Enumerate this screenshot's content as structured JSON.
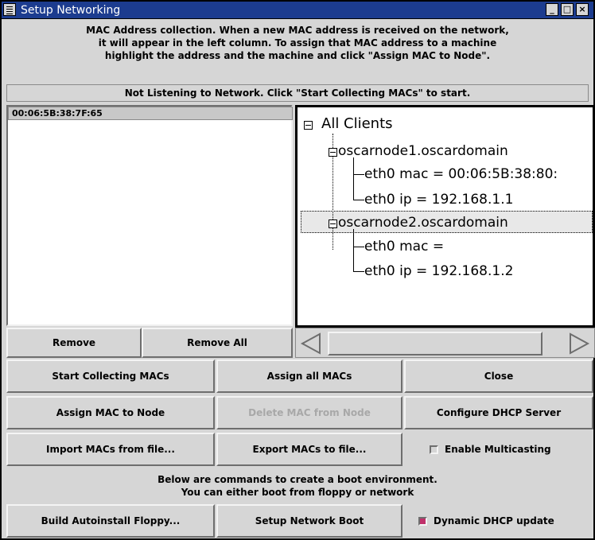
{
  "window": {
    "title": "Setup Networking"
  },
  "intro": {
    "lines": [
      "MAC Address collection.  When a new MAC address is received on the network,",
      "it will appear in the left column.  To assign that MAC address to a machine",
      "highlight the address and the machine and click \"Assign MAC to Node\"."
    ]
  },
  "status": "Not Listening to Network. Click \"Start Collecting MACs\" to start.",
  "mac_list": {
    "items": [
      "00:06:5B:38:7F:65"
    ]
  },
  "tree": {
    "root": "All Clients",
    "nodes": [
      {
        "name": "oscarnode1.oscardomain",
        "children": [
          "eth0 mac = 00:06:5B:38:80:",
          "eth0 ip = 192.168.1.1"
        ]
      },
      {
        "name": "oscarnode2.oscardomain",
        "children": [
          "eth0 mac =",
          "eth0 ip = 192.168.1.2"
        ]
      }
    ]
  },
  "list_buttons": {
    "remove": "Remove",
    "remove_all": "Remove All"
  },
  "buttons": {
    "start_collecting": "Start Collecting MACs",
    "assign_all": "Assign all MACs",
    "close": "Close",
    "assign_to_node": "Assign MAC to Node",
    "delete_from_node": "Delete MAC from Node",
    "configure_dhcp": "Configure DHCP Server",
    "import": "Import MACs from file...",
    "export": "Export MACs to file...",
    "build_floppy": "Build Autoinstall Floppy...",
    "setup_network_boot": "Setup Network Boot"
  },
  "checkboxes": {
    "multicast": {
      "label": "Enable Multicasting",
      "checked": false
    },
    "dynamic_dhcp": {
      "label": "Dynamic DHCP update",
      "checked": true
    }
  },
  "boot_note": {
    "lines": [
      "Below are commands to create a boot environment.",
      "You can either boot from floppy or network"
    ]
  },
  "colors": {
    "titlebar": "#1c3c8f",
    "checkbox_on": "#c0306a"
  }
}
